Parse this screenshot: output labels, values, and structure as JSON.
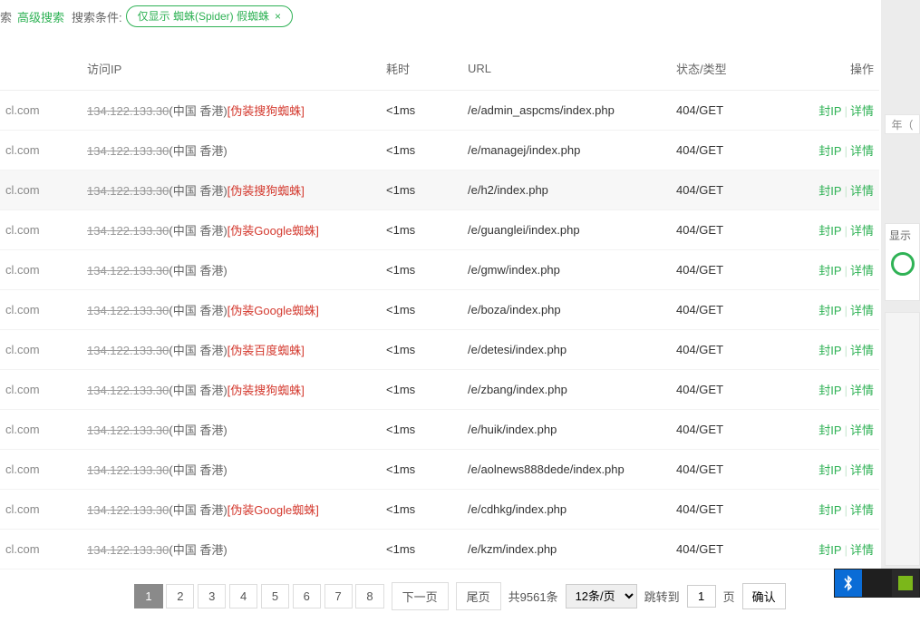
{
  "filter": {
    "prefix": "索",
    "adv": "高级搜索",
    "cond_label": "搜索条件:",
    "chip": "仅显示 蜘蛛(Spider) 假蜘蛛",
    "chip_close": "×"
  },
  "headers": {
    "ip": "访问IP",
    "dur": "耗时",
    "url": "URL",
    "status": "状态/类型",
    "op": "操作"
  },
  "actions": {
    "ban": "封IP",
    "sep": "|",
    "detail": "详情"
  },
  "right": {
    "box1": "年（",
    "box2": "显示"
  },
  "rows": [
    {
      "domain": "cl.com",
      "ip": "134.122.133.30",
      "loc": "(中国 香港)",
      "fake": "[伪装搜狗蜘蛛]",
      "dur": "<1ms",
      "url": "/e/admin_aspcms/index.php",
      "st": "404/GET",
      "hl": false
    },
    {
      "domain": "cl.com",
      "ip": "134.122.133.30",
      "loc": "(中国 香港)",
      "fake": "",
      "dur": "<1ms",
      "url": "/e/managej/index.php",
      "st": "404/GET",
      "hl": false
    },
    {
      "domain": "cl.com",
      "ip": "134.122.133.30",
      "loc": "(中国 香港)",
      "fake": "[伪装搜狗蜘蛛]",
      "dur": "<1ms",
      "url": "/e/h2/index.php",
      "st": "404/GET",
      "hl": true
    },
    {
      "domain": "cl.com",
      "ip": "134.122.133.30",
      "loc": "(中国 香港)",
      "fake": "[伪装Google蜘蛛]",
      "dur": "<1ms",
      "url": "/e/guanglei/index.php",
      "st": "404/GET",
      "hl": false
    },
    {
      "domain": "cl.com",
      "ip": "134.122.133.30",
      "loc": "(中国 香港)",
      "fake": "",
      "dur": "<1ms",
      "url": "/e/gmw/index.php",
      "st": "404/GET",
      "hl": false
    },
    {
      "domain": "cl.com",
      "ip": "134.122.133.30",
      "loc": "(中国 香港)",
      "fake": "[伪装Google蜘蛛]",
      "dur": "<1ms",
      "url": "/e/boza/index.php",
      "st": "404/GET",
      "hl": false
    },
    {
      "domain": "cl.com",
      "ip": "134.122.133.30",
      "loc": "(中国 香港)",
      "fake": "[伪装百度蜘蛛]",
      "dur": "<1ms",
      "url": "/e/detesi/index.php",
      "st": "404/GET",
      "hl": false
    },
    {
      "domain": "cl.com",
      "ip": "134.122.133.30",
      "loc": "(中国 香港)",
      "fake": "[伪装搜狗蜘蛛]",
      "dur": "<1ms",
      "url": "/e/zbang/index.php",
      "st": "404/GET",
      "hl": false
    },
    {
      "domain": "cl.com",
      "ip": "134.122.133.30",
      "loc": "(中国 香港)",
      "fake": "",
      "dur": "<1ms",
      "url": "/e/huik/index.php",
      "st": "404/GET",
      "hl": false
    },
    {
      "domain": "cl.com",
      "ip": "134.122.133.30",
      "loc": "(中国 香港)",
      "fake": "",
      "dur": "<1ms",
      "url": "/e/aolnews888dede/index.php",
      "st": "404/GET",
      "hl": false
    },
    {
      "domain": "cl.com",
      "ip": "134.122.133.30",
      "loc": "(中国 香港)",
      "fake": "[伪装Google蜘蛛]",
      "dur": "<1ms",
      "url": "/e/cdhkg/index.php",
      "st": "404/GET",
      "hl": false
    },
    {
      "domain": "cl.com",
      "ip": "134.122.133.30",
      "loc": "(中国 香港)",
      "fake": "",
      "dur": "<1ms",
      "url": "/e/kzm/index.php",
      "st": "404/GET",
      "hl": false
    }
  ],
  "pager": {
    "pages": [
      "1",
      "2",
      "3",
      "4",
      "5",
      "6",
      "7",
      "8"
    ],
    "active": "1",
    "next": "下一页",
    "last": "尾页",
    "total": "共9561条",
    "per": "12条/页",
    "jump_pre": "跳转到",
    "jump_val": "1",
    "jump_suf": "页",
    "ok": "确认"
  }
}
